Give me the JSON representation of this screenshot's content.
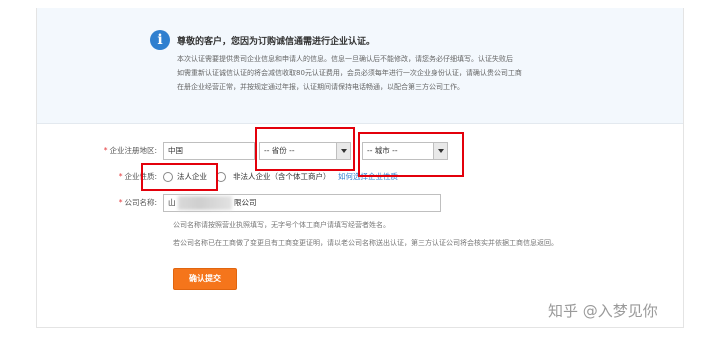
{
  "notice": {
    "title": "尊敬的客户，您因为订购诚信通需进行企业认证。",
    "lines": [
      "本次认证需要提供贵司企业信息和申请人的信息。信息一旦确认后不能修改，请您务必仔细填写。认证失败后",
      "如需重新认证诚信认证的将会减信收取80元认证费用，会员必须每年进行一次企业身份认证，请确认贵公司工商",
      "在册企业经营正常，并按规定通过年报，认证期间请保持电话畅通，以配合第三方公司工作。"
    ]
  },
  "form": {
    "region": {
      "label": "企业注册地区:",
      "country": "中国",
      "province": "-- 省份 --",
      "city": "-- 城市 --"
    },
    "nature": {
      "label": "企业性质:",
      "option_legal": "法人企业",
      "option_nonlegal": "非法人企业（含个体工商户）",
      "help_link": "如何选择企业性质"
    },
    "company": {
      "label": "公司名称:",
      "value_prefix": "山",
      "value_suffix": "限公司",
      "hint1": "公司名称请按照营业执照填写，无字号个体工商户请填写经营者姓名。",
      "hint2": "若公司名称已在工商做了变更且有工商变更证明，请以老公司名称送出认证，第三方认证公司将会核实并依据工商信息返回。"
    },
    "submit_label": "确认提交"
  },
  "watermark": "知乎 @入梦见你",
  "colors": {
    "highlight": "#e3000b",
    "submit": "#f5751b",
    "link": "#2f7fcf"
  }
}
